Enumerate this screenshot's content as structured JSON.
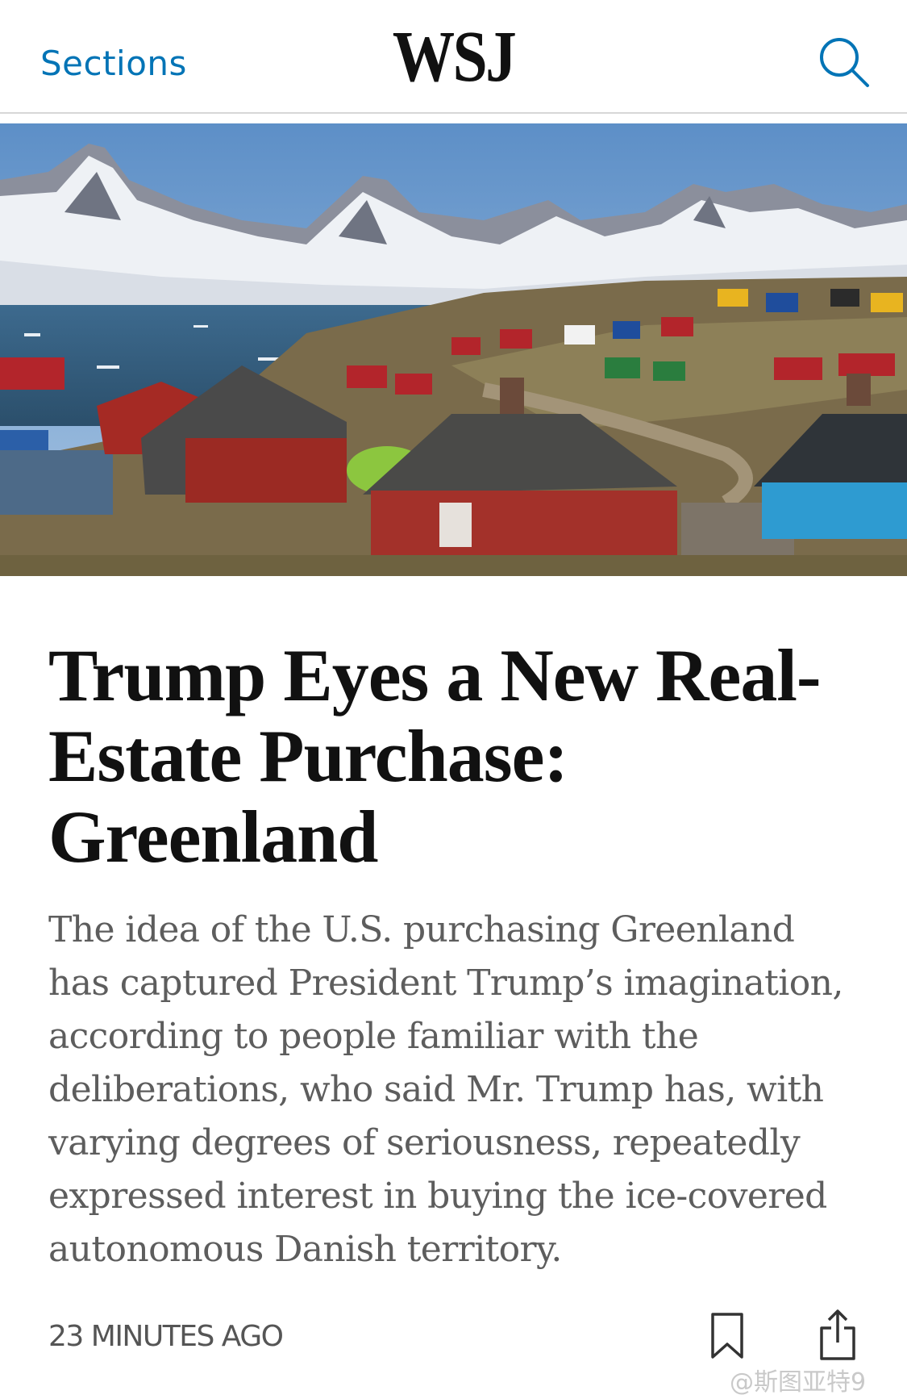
{
  "header": {
    "sections_label": "Sections",
    "logo_text": "WSJ"
  },
  "article": {
    "headline": "Trump Eyes a New Real-Estate Purchase: Greenland",
    "summary": "The idea of the U.S. purchasing Greenland has captured President Trump’s imagination, according to people familiar with the deliberations, who said Mr. Trump has, with varying degrees of seriousness, repeatedly expressed interest in buying the ice-covered autonomous Danish territory.",
    "timestamp": "23 MINUTES AGO"
  },
  "icons": {
    "search": "search-icon",
    "bookmark": "bookmark-icon",
    "share": "share-icon"
  },
  "watermark": {
    "text": "@斯图亚特9"
  },
  "colors": {
    "accent": "#0274b6",
    "headline": "#111111",
    "summary": "#5d5d5d"
  }
}
